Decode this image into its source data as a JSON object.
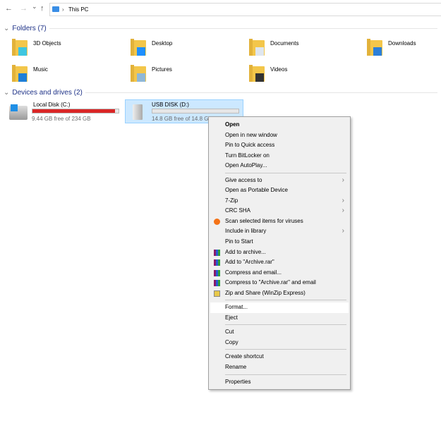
{
  "nav": {
    "back": "←",
    "forward": "→",
    "recent": "⌄",
    "up": "↑"
  },
  "address": {
    "separator": "›",
    "path": "This PC"
  },
  "folders": {
    "header": "Folders (7)",
    "items": [
      {
        "label": "3D Objects",
        "icon": "3d-objects-folder-icon"
      },
      {
        "label": "Desktop",
        "icon": "desktop-folder-icon"
      },
      {
        "label": "Documents",
        "icon": "documents-folder-icon"
      },
      {
        "label": "Downloads",
        "icon": "downloads-folder-icon"
      },
      {
        "label": "Music",
        "icon": "music-folder-icon"
      },
      {
        "label": "Pictures",
        "icon": "pictures-folder-icon"
      },
      {
        "label": "Videos",
        "icon": "videos-folder-icon"
      }
    ]
  },
  "drives": {
    "header": "Devices and drives (2)",
    "items": [
      {
        "label": "Local Disk (C:)",
        "free": "9.44 GB free of 234 GB",
        "used_fraction": 0.96,
        "bar_color": "#da2626"
      },
      {
        "label": "USB DISK (D:)",
        "free": "14.8 GB free of 14.8 GB",
        "used_fraction": 0.0,
        "bar_color": "#26a0da",
        "selected": true
      }
    ]
  },
  "menu": {
    "items": [
      {
        "label": "Open",
        "bold": true
      },
      {
        "label": "Open in new window"
      },
      {
        "label": "Pin to Quick access"
      },
      {
        "label": "Turn BitLocker on"
      },
      {
        "label": "Open AutoPlay..."
      },
      {
        "sep": true
      },
      {
        "label": "Give access to",
        "submenu": true
      },
      {
        "label": "Open as Portable Device"
      },
      {
        "label": "7-Zip",
        "submenu": true
      },
      {
        "label": "CRC SHA",
        "submenu": true
      },
      {
        "label": "Scan selected items for viruses",
        "icon": "avast-icon"
      },
      {
        "label": "Include in library",
        "submenu": true
      },
      {
        "label": "Pin to Start"
      },
      {
        "label": "Add to archive...",
        "icon": "winrar-icon"
      },
      {
        "label": "Add to \"Archive.rar\"",
        "icon": "winrar-icon"
      },
      {
        "label": "Compress and email...",
        "icon": "winrar-icon"
      },
      {
        "label": "Compress to \"Archive.rar\" and email",
        "icon": "winrar-icon"
      },
      {
        "label": "Zip and Share (WinZip Express)",
        "icon": "winzip-icon"
      },
      {
        "sep": true
      },
      {
        "label": "Format...",
        "highlighted": true
      },
      {
        "label": "Eject"
      },
      {
        "sep": true
      },
      {
        "label": "Cut"
      },
      {
        "label": "Copy"
      },
      {
        "sep": true
      },
      {
        "label": "Create shortcut"
      },
      {
        "label": "Rename"
      },
      {
        "sep": true
      },
      {
        "label": "Properties"
      }
    ]
  }
}
